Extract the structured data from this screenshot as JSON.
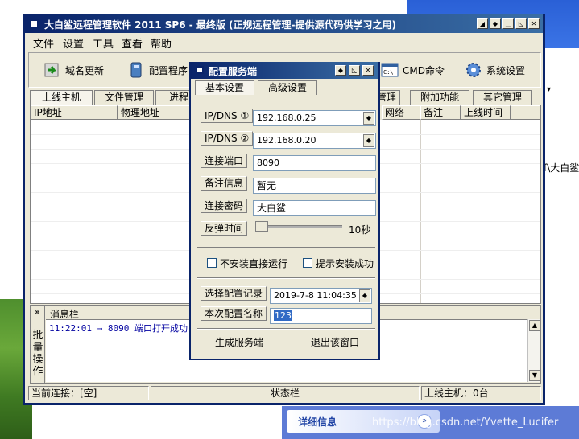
{
  "main_window": {
    "title": "大白鲨远程管理软件 2011 SP6 - 最终版 (正规远程管理-提供源代码供学习之用)",
    "menu": [
      "文件",
      "设置",
      "工具",
      "查看",
      "帮助"
    ],
    "toolbar": {
      "domain_update": "域名更新",
      "config_program": "配置程序",
      "cmd_command": "CMD命令",
      "system_settings": "系统设置"
    },
    "tabs": [
      "上线主机",
      "文件管理",
      "进程管",
      "管理",
      "附加功能",
      "其它管理"
    ],
    "columns": [
      "IP地址",
      "物理地址",
      "网络",
      "备注",
      "上线时间"
    ],
    "right_cut_label": "f\\大白鲨",
    "message_panel": {
      "expand_glyph": "»",
      "side_label": "批量操作",
      "title": "消息栏",
      "log_line": "11:22:01 → 8090 端口打开成功!"
    },
    "status_bar": {
      "connection": "当前连接：[空]",
      "status": "状态栏",
      "online_hosts": "上线主机：0台"
    }
  },
  "dialog": {
    "title": "配置服务端",
    "tabs": [
      "基本设置",
      "高级设置"
    ],
    "fields": {
      "ip_dns_1": {
        "label": "IP/DNS ①",
        "value": "192.168.0.25"
      },
      "ip_dns_2": {
        "label": "IP/DNS ②",
        "value": "192.168.0.20"
      },
      "port": {
        "label": "连接端口",
        "value": "8090"
      },
      "note": {
        "label": "备注信息",
        "value": "暂无"
      },
      "password": {
        "label": "连接密码",
        "value": "大白鲨"
      },
      "rebound": {
        "label": "反弹时间",
        "value": "10秒",
        "level": 0
      }
    },
    "checkboxes": {
      "no_install_run": {
        "label": "不安装直接运行",
        "checked": false
      },
      "prompt_success": {
        "label": "提示安装成功",
        "checked": false
      }
    },
    "record": {
      "label": "选择配置记录",
      "value": "2019-7-8 11:04:35"
    },
    "config_name": {
      "label": "本次配置名称",
      "value": "123"
    },
    "buttons": {
      "generate": "生成服务端",
      "exit": "退出该窗口"
    }
  },
  "taskbar": {
    "detail_label": "详细信息",
    "chevron": "»",
    "watermark": "https://blog.csdn.net/Yvette_Lucifer"
  },
  "colors": {
    "title_bar": "#0a246a",
    "title_bar_end": "#3a6ea5",
    "window_face": "#ece9d8",
    "log_text": "#0000a0",
    "selection": "#316ac5"
  }
}
